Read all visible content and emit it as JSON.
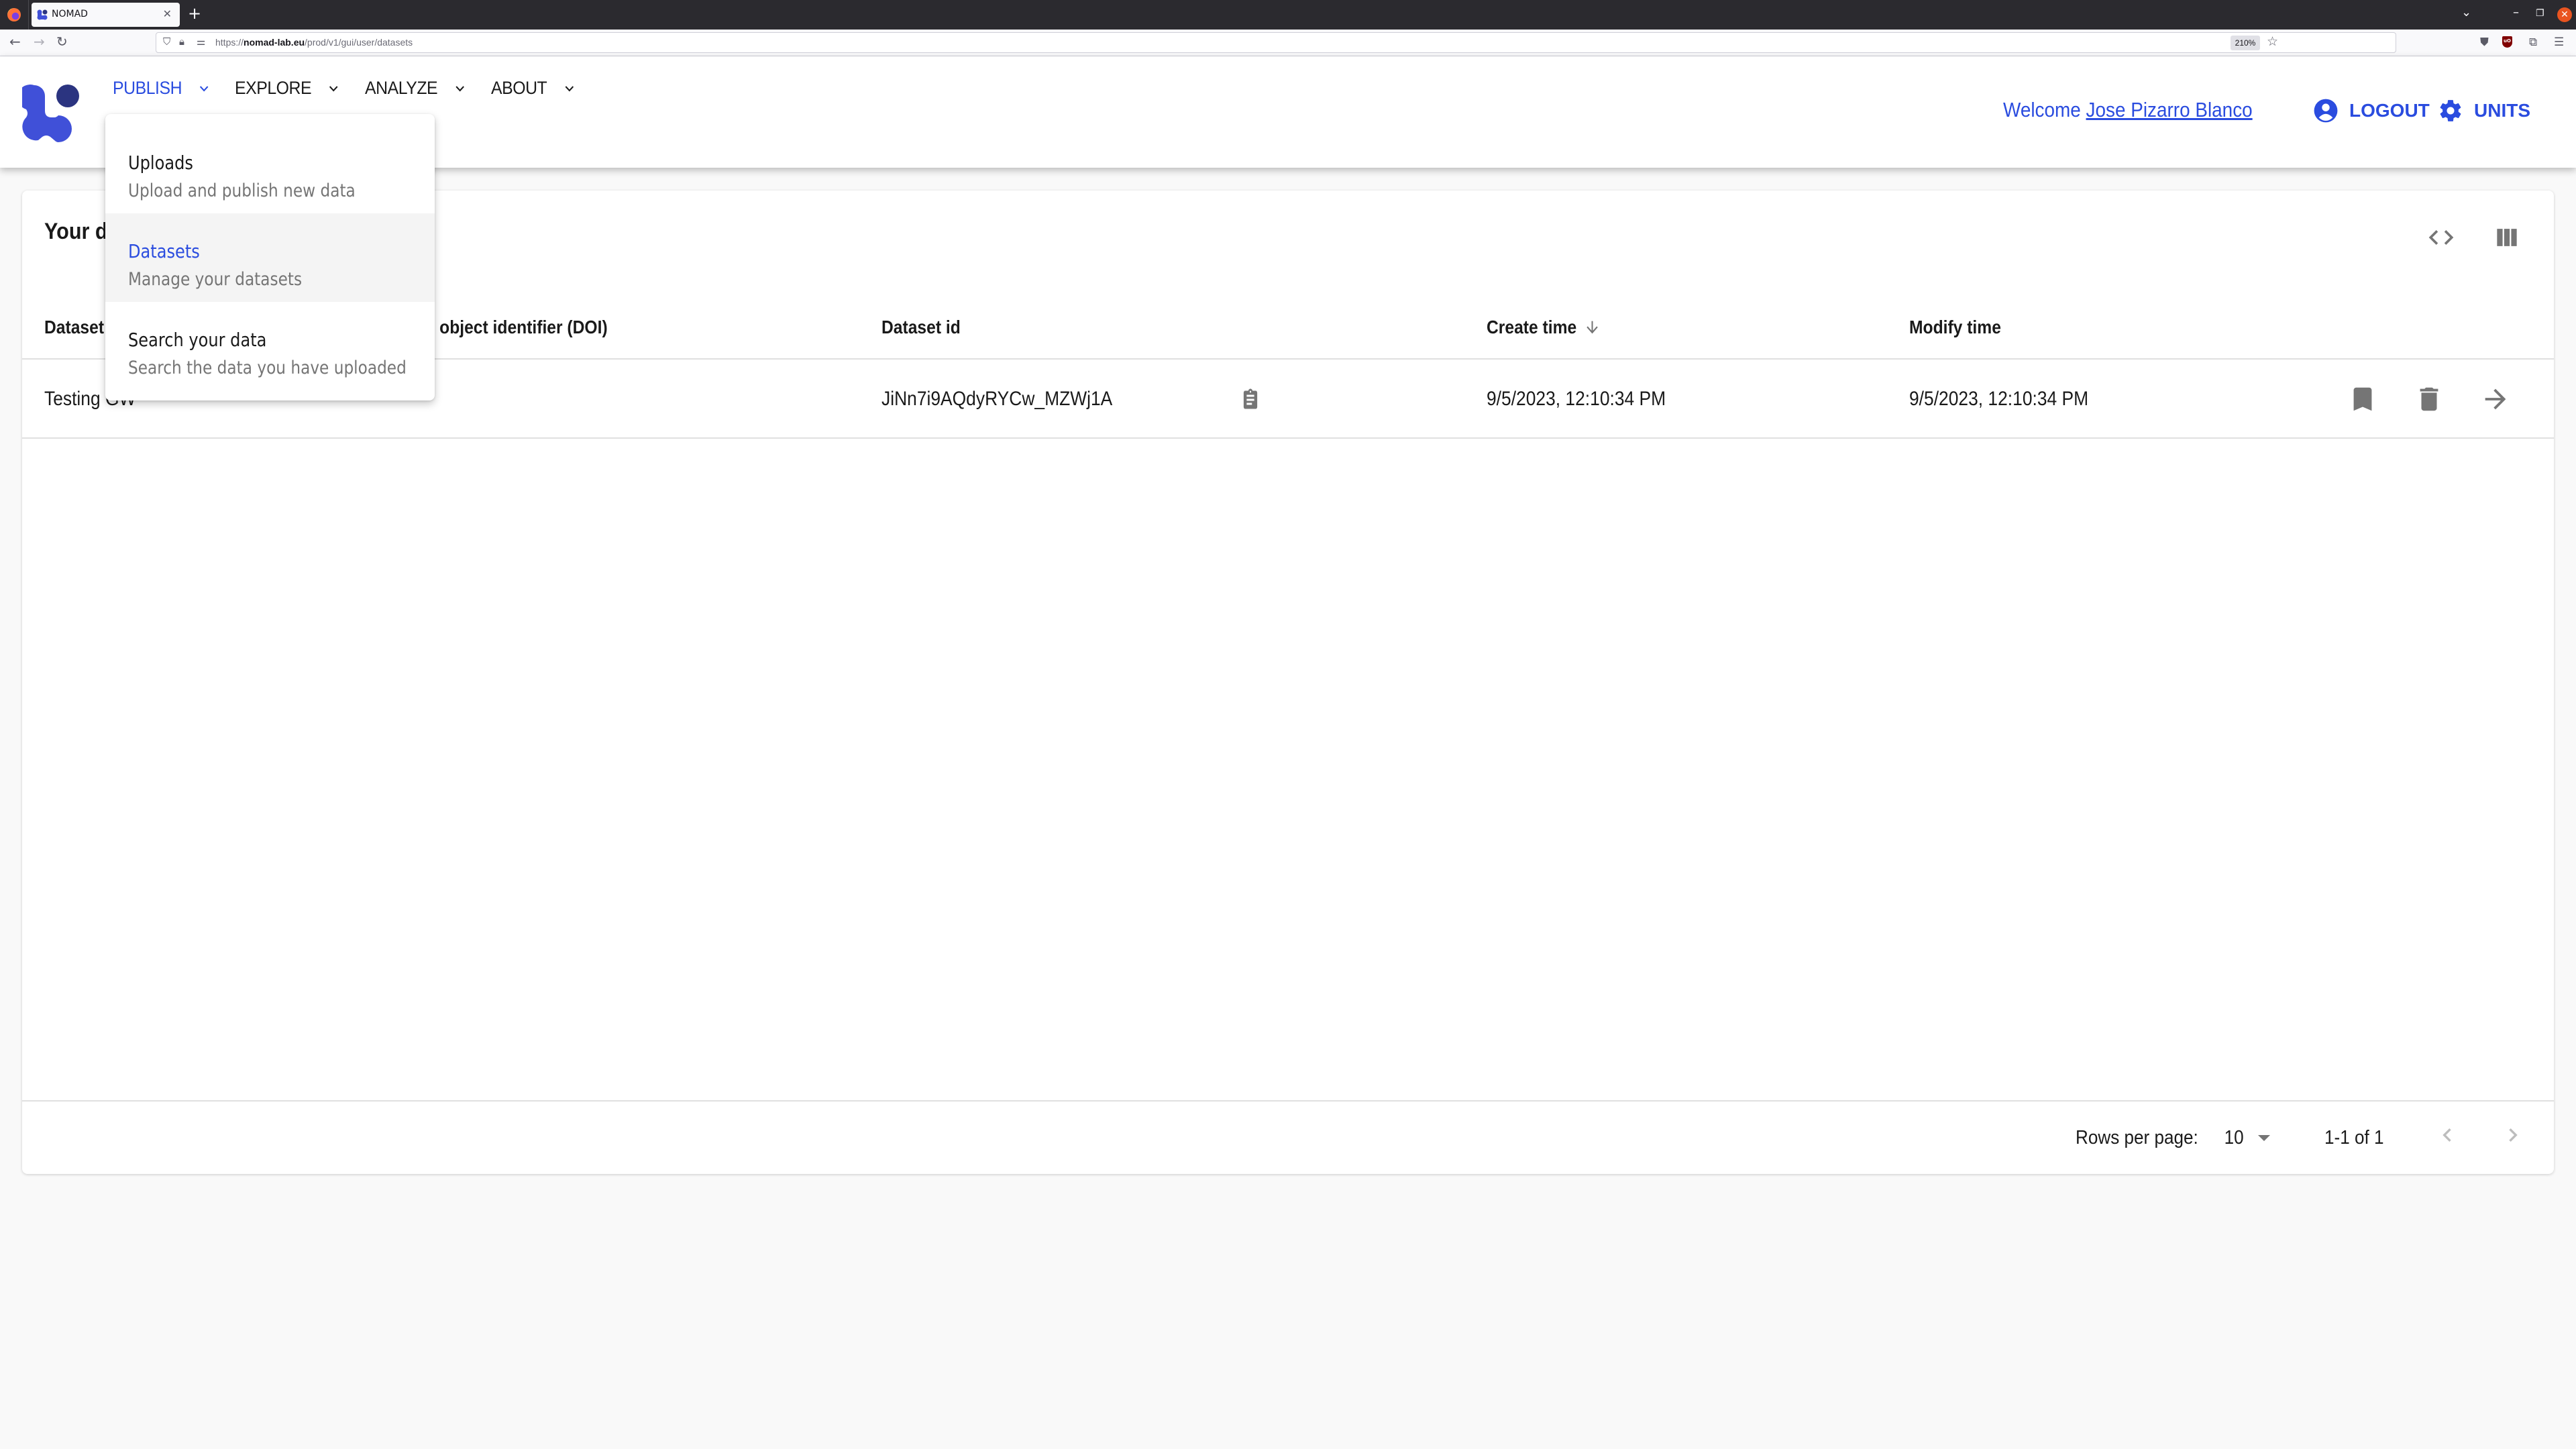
{
  "browser": {
    "tab_title": "NOMAD",
    "url_prefix": "https://",
    "url_host": "nomad-lab.eu",
    "url_path": "/prod/v1/gui/user/datasets",
    "zoom_level": "210%"
  },
  "header": {
    "nav": [
      {
        "label": "PUBLISH",
        "active": true
      },
      {
        "label": "EXPLORE",
        "active": false
      },
      {
        "label": "ANALYZE",
        "active": false
      },
      {
        "label": "ABOUT",
        "active": false
      }
    ],
    "welcome_prefix": "Welcome",
    "user_name": "Jose Pizarro Blanco",
    "logout_label": "LOGOUT",
    "units_label": "UNITS"
  },
  "publish_menu": {
    "items": [
      {
        "label": "Uploads",
        "description": "Upload and publish new data",
        "selected": false
      },
      {
        "label": "Datasets",
        "description": "Manage your datasets",
        "selected": true
      },
      {
        "label": "Search your data",
        "description": "Search the data you have uploaded",
        "selected": false
      }
    ]
  },
  "datasets": {
    "title": "Your datasets",
    "columns": [
      "Dataset name",
      "Digital object identifier (DOI)",
      "Dataset id",
      "Create time",
      "Modify time"
    ],
    "sort_column": "Create time",
    "sort_direction": "descending",
    "rows": [
      {
        "name": "Testing GW",
        "doi": "",
        "id": "JiNn7i9AQdyRYCw_MZWj1A",
        "create_time": "9/5/2023, 12:10:34 PM",
        "modify_time": "9/5/2023, 12:10:34 PM"
      }
    ],
    "pagination": {
      "rows_per_page_label": "Rows per page:",
      "rows_per_page": "10",
      "range": "1-1 of 1"
    }
  },
  "colors": {
    "accent": "#2a4cdf",
    "logo_light": "#4050d8",
    "logo_dark": "#2b3480",
    "icon_gray": "#757575",
    "selected_bg": "#f4f4f4"
  }
}
